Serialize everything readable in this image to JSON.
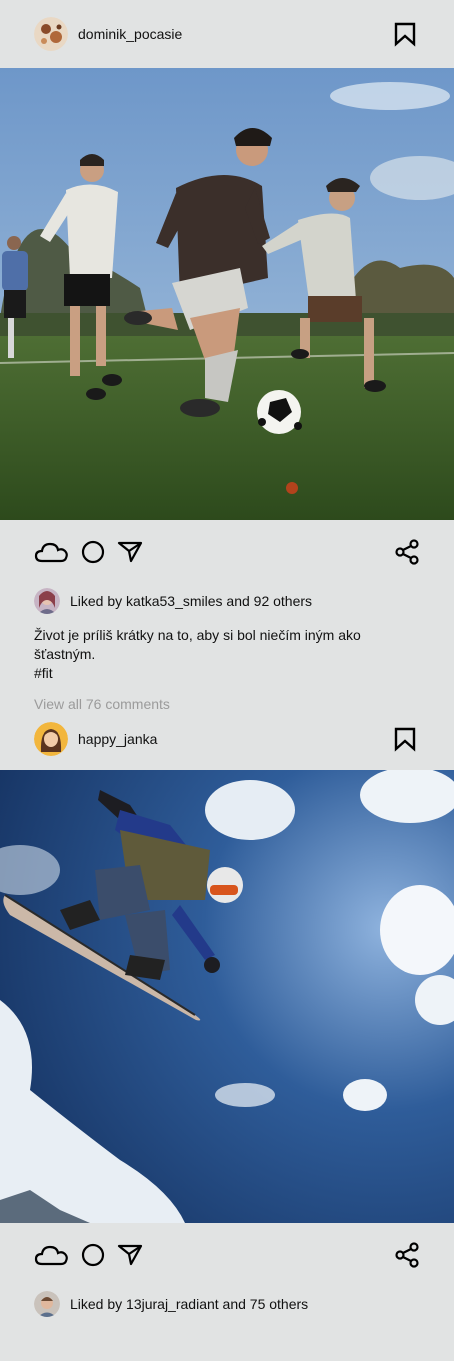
{
  "posts": [
    {
      "username": "dominik_pocasie",
      "likes_text": "Liked by katka53_smiles and 92 others",
      "caption_line1": "Život je príliš krátky na to, aby si bol niečím iným ako šťastným.",
      "caption_line2": "#fit",
      "comments_link": "View all 76 comments"
    },
    {
      "username": "happy_janka",
      "likes_text": "Liked by 13juraj_radiant and 75 others"
    }
  ],
  "icons": {
    "bookmark": "bookmark-icon",
    "weather": "cloud-icon",
    "comment": "circle-icon",
    "send": "send-icon",
    "share": "share-icon"
  },
  "colors": {
    "background": "#e1e3e3",
    "text": "#111111",
    "muted": "#9b9b9b"
  }
}
